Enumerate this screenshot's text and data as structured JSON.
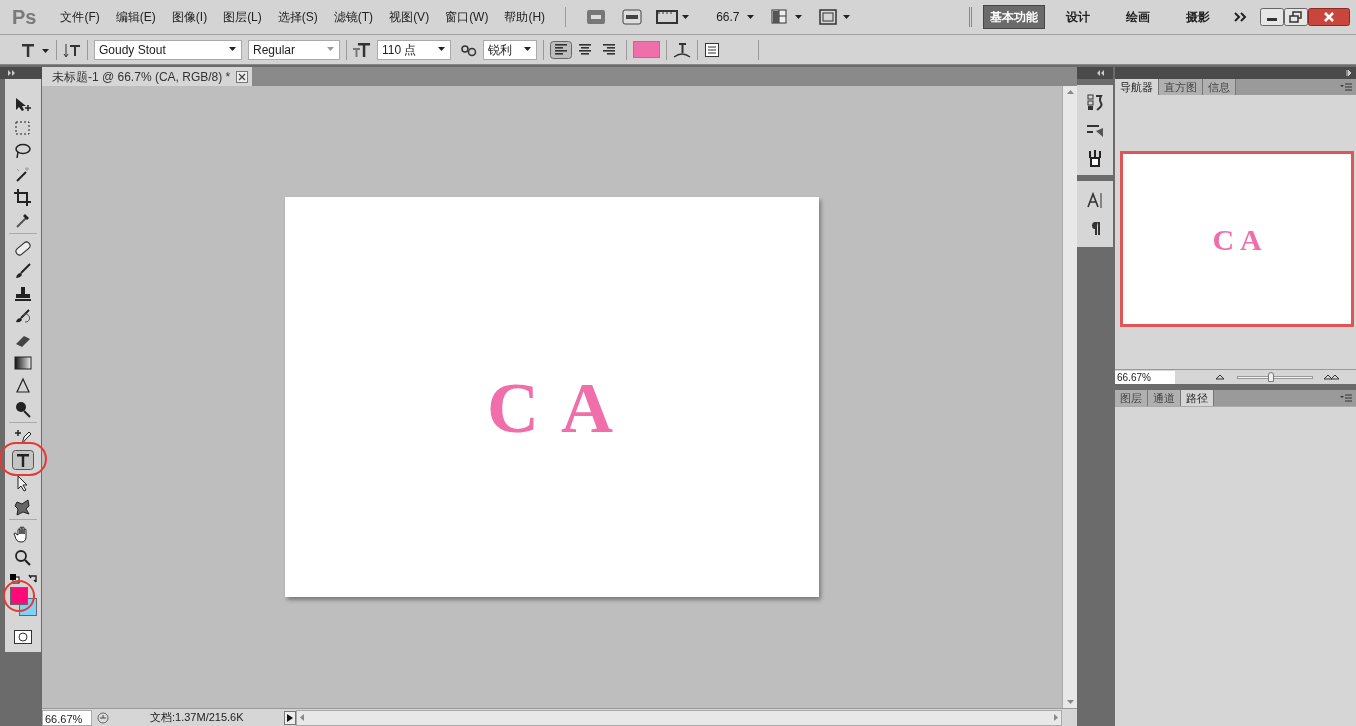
{
  "menu_bar": {
    "logo": "Ps",
    "menus": [
      "文件(F)",
      "编辑(E)",
      "图像(I)",
      "图层(L)",
      "选择(S)",
      "滤镜(T)",
      "视图(V)",
      "窗口(W)",
      "帮助(H)"
    ],
    "zoom": "66.7",
    "workspaces": [
      {
        "label": "基本功能",
        "selected": true
      },
      {
        "label": "设计",
        "selected": false
      },
      {
        "label": "绘画",
        "selected": false
      },
      {
        "label": "摄影",
        "selected": false
      }
    ]
  },
  "options_bar": {
    "font_family": "Goudy Stout",
    "font_style": "Regular",
    "font_size": "110 点",
    "antialias": "锐利",
    "align": [
      {
        "kind": "left",
        "selected": true
      },
      {
        "kind": "center",
        "selected": false
      },
      {
        "kind": "right",
        "selected": false
      }
    ],
    "text_color": {
      "color": "#f06ea9"
    }
  },
  "document_tab": {
    "title": "未标题-1 @ 66.7% (CA, RGB/8) *"
  },
  "tools": [
    {
      "kind": "move",
      "selected": false,
      "circled": false
    },
    {
      "kind": "marquee",
      "selected": false,
      "circled": false
    },
    {
      "kind": "lasso",
      "selected": false,
      "circled": false
    },
    {
      "kind": "wand",
      "selected": false,
      "circled": false
    },
    {
      "kind": "crop",
      "selected": false,
      "circled": false
    },
    {
      "kind": "eyedropper",
      "selected": false,
      "circled": false
    },
    {
      "kind": "heal",
      "selected": false,
      "circled": false
    },
    {
      "kind": "brush",
      "selected": false,
      "circled": false
    },
    {
      "kind": "stamp",
      "selected": false,
      "circled": false
    },
    {
      "kind": "history",
      "selected": false,
      "circled": false
    },
    {
      "kind": "eraser",
      "selected": false,
      "circled": false
    },
    {
      "kind": "gradient",
      "selected": false,
      "circled": false
    },
    {
      "kind": "blur",
      "selected": false,
      "circled": false
    },
    {
      "kind": "dodge",
      "selected": false,
      "circled": false
    },
    {
      "kind": "pen",
      "selected": false,
      "circled": false
    },
    {
      "kind": "type",
      "selected": true,
      "circled": true
    },
    {
      "kind": "select",
      "selected": false,
      "circled": false
    },
    {
      "kind": "shape",
      "selected": false,
      "circled": false
    },
    {
      "kind": "hand",
      "selected": false,
      "circled": false
    },
    {
      "kind": "zoom",
      "selected": false,
      "circled": false
    }
  ],
  "colors": {
    "foreground": {
      "color": "#ff0a78"
    },
    "background": {
      "color": "#7dd3f7"
    },
    "circled": true
  },
  "canvas": {
    "text": "C A",
    "color": "#f06ea9"
  },
  "navigator": {
    "tabs": [
      {
        "label": "导航器",
        "selected": true
      },
      {
        "label": "直方图",
        "selected": false
      },
      {
        "label": "信息",
        "selected": false
      }
    ],
    "preview_text": "C A",
    "zoom": "66.67%",
    "level": 0.45
  },
  "layers_panel": {
    "tabs": [
      {
        "label": "图层",
        "selected": false
      },
      {
        "label": "通道",
        "selected": false
      },
      {
        "label": "路径",
        "selected": true
      }
    ]
  },
  "status_bar": {
    "zoom": "66.67%",
    "info": "文档:1.37M/215.6K"
  }
}
